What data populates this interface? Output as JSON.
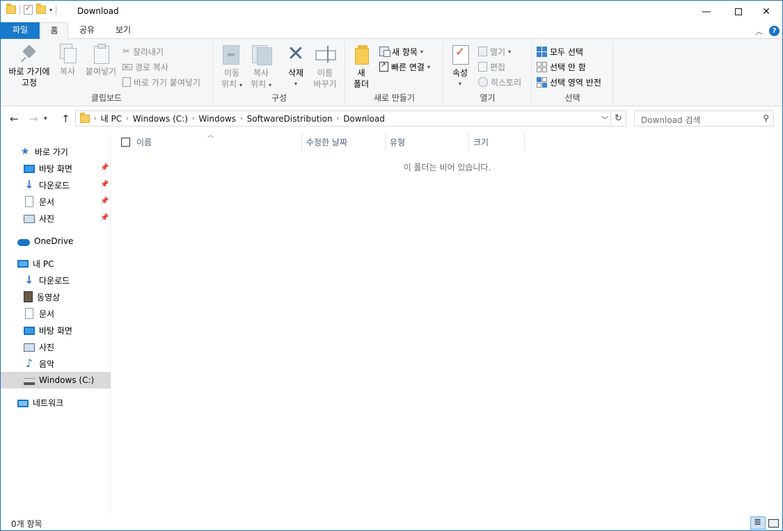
{
  "window": {
    "title": "Download",
    "min_glyph": "—",
    "close_glyph": "✕"
  },
  "ribbon_tabs": {
    "file": "파일",
    "home": "홈",
    "share": "공유",
    "view": "보기"
  },
  "ribbon": {
    "clipboard": {
      "group_label": "클립보드",
      "pin_line1": "바로 가기에",
      "pin_line2": "고정",
      "copy": "복사",
      "paste": "붙여넣기",
      "cut": "잘라내기",
      "copy_path": "경로 복사",
      "paste_shortcut": "바로 가기 붙여넣기"
    },
    "organize": {
      "group_label": "구성",
      "move_line1": "이동",
      "move_line2": "위치",
      "copyto_line1": "복사",
      "copyto_line2": "위치",
      "delete": "삭제",
      "rename_line1": "이름",
      "rename_line2": "바꾸기"
    },
    "new": {
      "group_label": "새로 만들기",
      "folder_line1": "새",
      "folder_line2": "폴더",
      "new_item": "새 항목",
      "easy_access": "빠른 연결"
    },
    "open": {
      "group_label": "열기",
      "properties": "속성",
      "open": "열기",
      "edit": "편집",
      "history": "히스토리"
    },
    "select": {
      "group_label": "선택",
      "select_all": "모두 선택",
      "select_none": "선택 안 함",
      "invert": "선택 영역 반전"
    }
  },
  "address": {
    "crumbs": [
      "내 PC",
      "Windows (C:)",
      "Windows",
      "SoftwareDistribution",
      "Download"
    ],
    "search_placeholder": "Download 검색"
  },
  "nav": {
    "quick_access": "바로 가기",
    "qa_items": [
      "바탕 화면",
      "다운로드",
      "문서",
      "사진"
    ],
    "onedrive": "OneDrive",
    "this_pc": "내 PC",
    "pc_items": [
      "다운로드",
      "동영상",
      "문서",
      "바탕 화면",
      "사진",
      "음악",
      "Windows (C:)"
    ],
    "network": "네트워크",
    "selected_item": "Windows (C:)"
  },
  "columns": {
    "name": "이름",
    "modified": "수정한 날짜",
    "type": "유형",
    "size": "크기"
  },
  "content": {
    "empty_message": "이 폴더는 비어 있습니다."
  },
  "status": {
    "item_count": "0개 항목"
  }
}
